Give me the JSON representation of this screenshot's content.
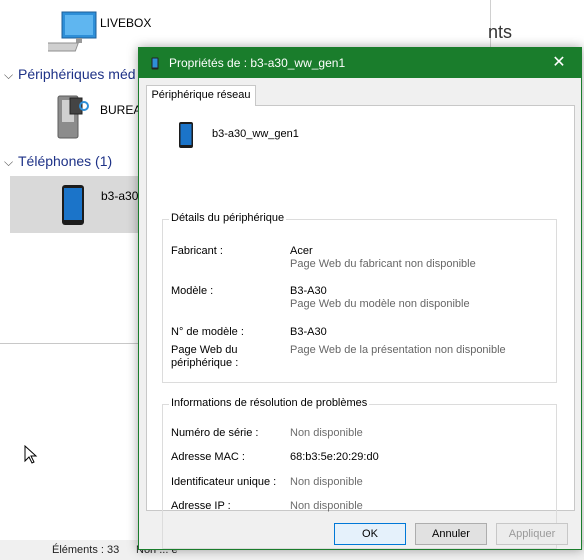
{
  "explorer": {
    "livebox_label": "LIVEBOX",
    "group_peripherals": "Périphériques méd",
    "bureau_label": "BUREA",
    "group_phones": "Téléphones (1)",
    "phone_label": "b3-a30_",
    "right_pane_title": "nts",
    "status": {
      "count": "Éléments : 33",
      "truncated": "Non ... é"
    }
  },
  "dialog": {
    "title": "Propriétés de : b3-a30_ww_gen1",
    "close_glyph": "✕",
    "tab_label": "Périphérique réseau",
    "device_name": "b3-a30_ww_gen1",
    "details": {
      "legend": "Détails du périphérique",
      "manufacturer_label": "Fabricant :",
      "manufacturer_value": "Acer",
      "manufacturer_web": "Page Web du fabricant non disponible",
      "model_label": "Modèle :",
      "model_value": "B3-A30",
      "model_web": "Page Web du modèle non disponible",
      "model_number_label": "N° de modèle :",
      "model_number_value": "B3-A30",
      "webpage_label_1": "Page Web du",
      "webpage_label_2": "périphérique :",
      "webpage_value": "Page Web de la présentation non disponible"
    },
    "troubleshooting": {
      "legend": "Informations de résolution de problèmes",
      "serial_label": "Numéro de série :",
      "serial_value": "Non disponible",
      "mac_label": "Adresse MAC :",
      "mac_value": "68:b3:5e:20:29:d0",
      "uid_label": "Identificateur unique :",
      "uid_value": "Non disponible",
      "ip_label": "Adresse IP :",
      "ip_value": "Non disponible"
    },
    "buttons": {
      "ok": "OK",
      "cancel": "Annuler",
      "apply": "Appliquer"
    }
  },
  "colors": {
    "titlebar": "#1a7d2c",
    "group_header": "#1e3287"
  }
}
